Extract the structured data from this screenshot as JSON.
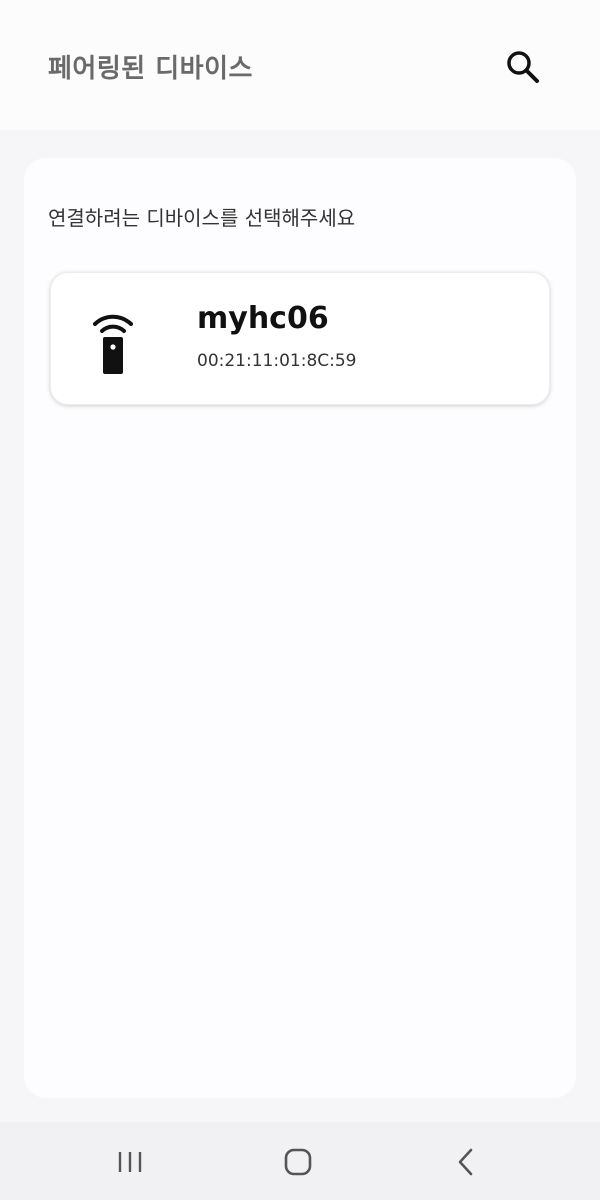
{
  "header": {
    "title": "페어링된 디바이스",
    "search_icon": "search-icon"
  },
  "panel": {
    "subtitle": "연결하려는 디바이스를 선택해주세요",
    "devices": [
      {
        "name": "myhc06",
        "address": "00:21:11:01:8C:59",
        "icon": "wireless-remote-icon"
      }
    ]
  },
  "navbar": {
    "items": [
      {
        "icon": "recent-apps-icon"
      },
      {
        "icon": "home-icon"
      },
      {
        "icon": "back-icon"
      }
    ]
  },
  "colors": {
    "background": "#f6f5f8",
    "header": "#fcfcfc",
    "title": "#6a6a6a",
    "card": "#ffffff",
    "navbar": "#f1f0f3"
  }
}
